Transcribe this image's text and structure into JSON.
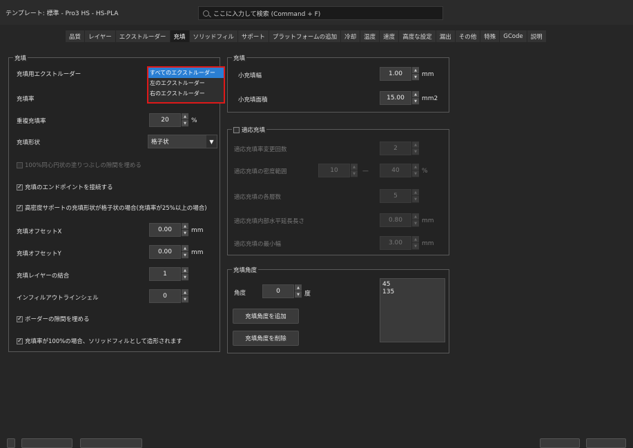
{
  "window": {
    "title": "テンプレート: 標準 - Pro3 HS - HS-PLA"
  },
  "search": {
    "placeholder": "ここに入力して検索 (Command + F)"
  },
  "tabs": [
    {
      "label": "品質"
    },
    {
      "label": "レイヤー"
    },
    {
      "label": "エクストルーダー"
    },
    {
      "label": "充填"
    },
    {
      "label": "ソリッドフィル"
    },
    {
      "label": "サポート"
    },
    {
      "label": "プラットフォームの追加"
    },
    {
      "label": "冷却"
    },
    {
      "label": "温度"
    },
    {
      "label": "速度"
    },
    {
      "label": "高度な設定"
    },
    {
      "label": "漏出"
    },
    {
      "label": "その他"
    },
    {
      "label": "特殊"
    },
    {
      "label": "GCode"
    },
    {
      "label": "説明"
    }
  ],
  "left": {
    "legend": "充填",
    "extruder_label": "充填用エクストルーダー",
    "extruder_options": [
      "すべてのエクストルーダー",
      "左のエクストルーダー",
      "右のエクストルーダー"
    ],
    "infill_rate_label": "充填率",
    "overlap_label": "重複充填率",
    "overlap_value": "20",
    "overlap_unit": "%",
    "pattern_label": "充填形状",
    "pattern_value": "格子状",
    "fill_gaps_concentric": "100%同心円状の塗りつぶしの隙間を埋める",
    "connect_endpoints": "充填のエンドポイントを接続する",
    "dense_support": "高密度サポートの充填形状が格子状の場合(充填率が25%以上の場合)",
    "offset_x_label": "充填オフセットX",
    "offset_x_value": "0.00",
    "offset_y_label": "充填オフセットY",
    "offset_y_value": "0.00",
    "unit_mm": "mm",
    "combine_label": "充填レイヤーの結合",
    "combine_value": "1",
    "outline_shells_label": "インフィルアウトラインシェル",
    "outline_shells_value": "0",
    "border_gaps": "ボーダーの隙間を埋める",
    "solid_at_100": "充填率が100%の場合、ソリッドフィルとして造形されます"
  },
  "right_top": {
    "legend": "充填",
    "min_width_label": "小充填幅",
    "min_width_value": "1.00",
    "min_width_unit": "mm",
    "min_area_label": "小充填面積",
    "min_area_value": "15.00",
    "min_area_unit": "mm2"
  },
  "adaptive": {
    "legend": "適応充填",
    "change_count_label": "適応充填率変更回数",
    "change_count_value": "2",
    "density_range_label": "適応充填の密度範囲",
    "density_min": "10",
    "density_dash": "—",
    "density_max": "40",
    "density_unit": "%",
    "layers_label": "適応充填の各層数",
    "layers_value": "5",
    "horiz_length_label": "適応充填内部水平延長長さ",
    "horiz_length_value": "0.80",
    "min_width_label": "適応充填の最小幅",
    "min_width_value": "3.00",
    "unit_mm": "mm"
  },
  "angles": {
    "legend": "充填角度",
    "angle_label": "角度",
    "angle_value": "0",
    "angle_unit": "度",
    "add_button": "充填角度を追加",
    "remove_button": "充填角度を削除",
    "list": [
      "45",
      "135"
    ]
  },
  "colors": {
    "accent": "#2a7fd4",
    "highlight_border": "#e01919",
    "background": "#262626"
  }
}
